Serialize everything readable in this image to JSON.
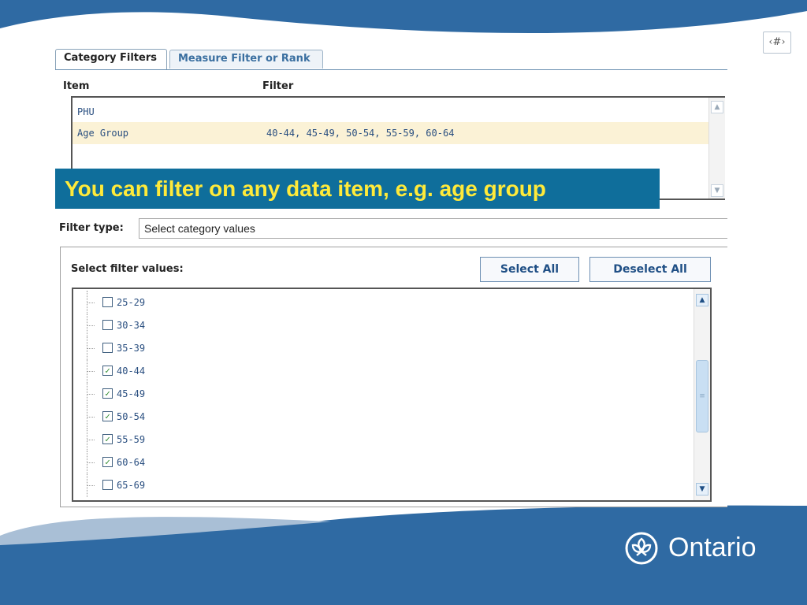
{
  "slide": {
    "number_placeholder": "‹#›",
    "brand": "Ontario"
  },
  "tabs": [
    {
      "label": "Category Filters",
      "active": true
    },
    {
      "label": "Measure Filter or Rank",
      "active": false
    }
  ],
  "item_table": {
    "headers": {
      "item": "Item",
      "filter": "Filter"
    },
    "rows": [
      {
        "item": "PHU",
        "filter": ""
      },
      {
        "item": "Age Group",
        "filter": "40-44, 45-49, 50-54, 55-59, 60-64",
        "selected": true
      }
    ]
  },
  "callout": "You can filter on any data item, e.g. age group",
  "filter_type": {
    "label": "Filter type:",
    "value": "Select category values"
  },
  "filter_values": {
    "label": "Select filter values:",
    "select_all": "Select All",
    "deselect_all": "Deselect All",
    "items": [
      {
        "label": "25-29",
        "checked": false
      },
      {
        "label": "30-34",
        "checked": false
      },
      {
        "label": "35-39",
        "checked": false
      },
      {
        "label": "40-44",
        "checked": true
      },
      {
        "label": "45-49",
        "checked": true
      },
      {
        "label": "50-54",
        "checked": true
      },
      {
        "label": "55-59",
        "checked": true
      },
      {
        "label": "60-64",
        "checked": true
      },
      {
        "label": "65-69",
        "checked": false
      }
    ]
  },
  "colors": {
    "theme_blue": "#2f6aa3",
    "callout_bg": "#0f6e9b",
    "callout_text": "#ffea3a"
  }
}
